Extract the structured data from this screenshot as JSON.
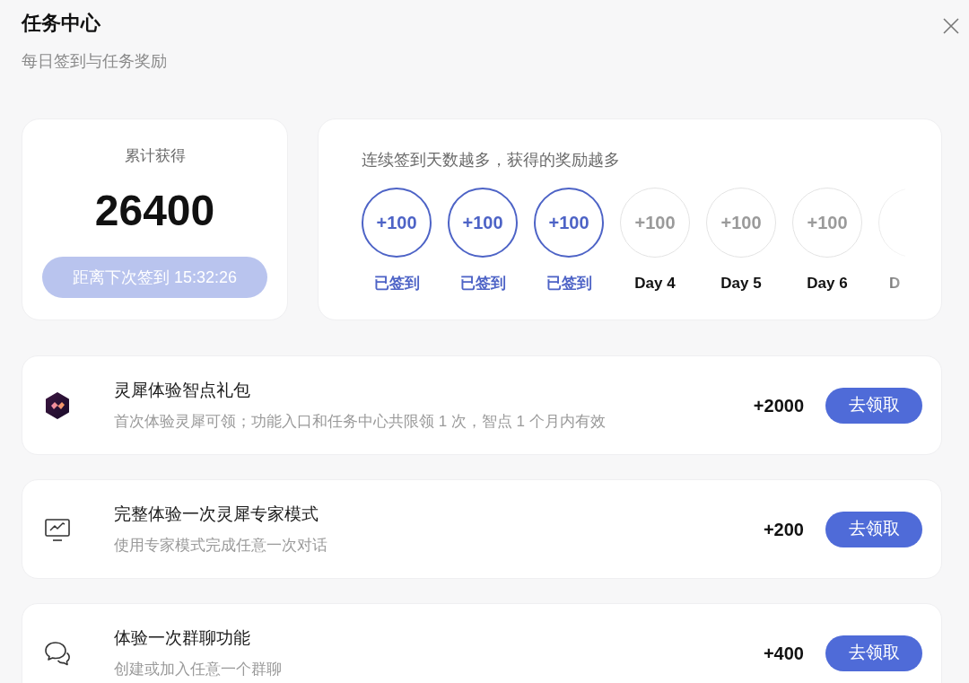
{
  "header": {
    "title": "任务中心",
    "subtitle": "每日签到与任务奖励"
  },
  "summary": {
    "label": "累计获得",
    "total": "26400",
    "countdown": "距离下次签到 15:32:26",
    "disabled": true
  },
  "checkin": {
    "hint": "连续签到天数越多，获得的奖励越多",
    "days": [
      {
        "reward": "+100",
        "label": "已签到",
        "checked": true
      },
      {
        "reward": "+100",
        "label": "已签到",
        "checked": true
      },
      {
        "reward": "+100",
        "label": "已签到",
        "checked": true
      },
      {
        "reward": "+100",
        "label": "Day 4",
        "checked": false
      },
      {
        "reward": "+100",
        "label": "Day 5",
        "checked": false
      },
      {
        "reward": "+100",
        "label": "Day 6",
        "checked": false
      },
      {
        "label": "D",
        "checked": false
      }
    ]
  },
  "tasks": [
    {
      "kind": "app",
      "title": "灵犀体验智点礼包",
      "description": "首次体验灵犀可领；功能入口和任务中心共限领 1 次，智点 1 个月内有效",
      "reward": "+2000",
      "action": "去领取"
    },
    {
      "kind": "expert",
      "title": "完整体验一次灵犀专家模式",
      "description": "使用专家模式完成任意一次对话",
      "reward": "+200",
      "action": "去领取"
    },
    {
      "kind": "group-chat",
      "title": "体验一次群聊功能",
      "description": "创建或加入任意一个群聊",
      "reward": "+400",
      "action": "去领取"
    }
  ]
}
